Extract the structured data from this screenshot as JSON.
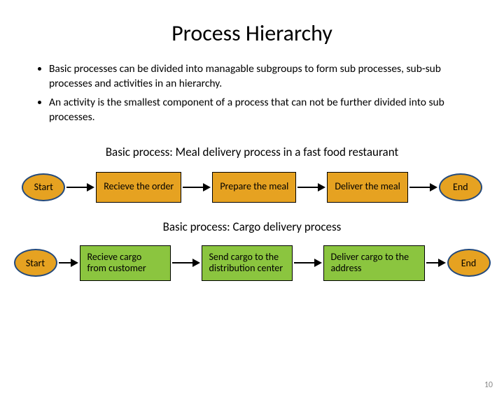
{
  "title": "Process Hierarchy",
  "bullets": [
    "Basic processes can be divided into managable subgroups to form sub processes, sub-sub processes and activities in an hierarchy.",
    "An activity is the smallest component of a process that can not be further divided into sub processes."
  ],
  "flow1": {
    "heading": "Basic process: Meal delivery process in a fast food restaurant",
    "start": "Start",
    "steps": [
      "Recieve the order",
      "Prepare the meal",
      "Deliver the meal"
    ],
    "end": "End"
  },
  "flow2": {
    "heading": "Basic process: Cargo delivery process",
    "start": "Start",
    "steps": [
      "Recieve cargo from customer",
      "Send cargo to the distribution center",
      "Deliver cargo to the address"
    ],
    "end": "End"
  },
  "page_number": "10"
}
